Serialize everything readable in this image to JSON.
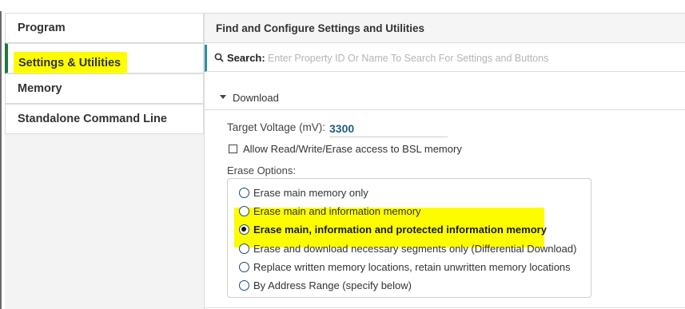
{
  "sidebar": {
    "items": [
      {
        "label": "Program"
      },
      {
        "label": "Settings & Utilities"
      },
      {
        "label": "Memory"
      },
      {
        "label": "Standalone Command Line"
      }
    ]
  },
  "main": {
    "header": "Find and Configure Settings and Utilities",
    "search": {
      "label": "Search:",
      "placeholder": "Enter Property ID Or Name To Search For Settings and Buttons"
    },
    "section": {
      "title": "Download",
      "target_voltage_label": "Target Voltage (mV):",
      "target_voltage_value": "3300",
      "bsl_checkbox_label": "Allow Read/Write/Erase access to BSL memory",
      "bsl_checked": false,
      "erase_options_label": "Erase Options:",
      "erase_options": [
        {
          "label": "Erase main memory only",
          "selected": false
        },
        {
          "label": "Erase main and information memory",
          "selected": false
        },
        {
          "label": "Erase main, information and protected information memory",
          "selected": true
        },
        {
          "label": "Erase and download necessary segments only (Differential Download)",
          "selected": false
        },
        {
          "label": "Replace written memory locations, retain unwritten memory locations",
          "selected": false
        },
        {
          "label": "By Address Range (specify below)",
          "selected": false
        }
      ]
    }
  },
  "colors": {
    "highlight": "#fdfd00",
    "active_indicator": "#1f7a3a",
    "search_accent": "#2a8fa8",
    "voltage_value": "#1c5f7e"
  }
}
